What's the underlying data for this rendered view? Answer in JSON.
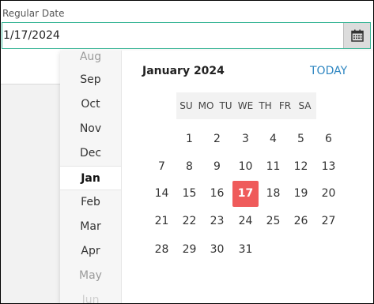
{
  "field": {
    "label": "Regular Date",
    "value": "1/17/2024",
    "button_icon": "calendar-icon"
  },
  "picker": {
    "title": "January 2024",
    "today_label": "TODAY",
    "months": [
      "Aug",
      "Sep",
      "Oct",
      "Nov",
      "Dec",
      "Jan",
      "Feb",
      "Mar",
      "Apr",
      "May",
      "Jun"
    ],
    "selected_month": "Jan",
    "weekdays": [
      "SU",
      "MO",
      "TU",
      "WE",
      "TH",
      "FR",
      "SA"
    ],
    "weeks": [
      [
        "",
        "",
        "1",
        "2",
        "3",
        "4",
        "5",
        "6"
      ],
      [
        "7",
        "8",
        "9",
        "10",
        "11",
        "12",
        "13"
      ],
      [
        "14",
        "15",
        "16",
        "17",
        "18",
        "19",
        "20"
      ],
      [
        "21",
        "22",
        "23",
        "24",
        "25",
        "26",
        "27"
      ],
      [
        "28",
        "29",
        "30",
        "31"
      ]
    ],
    "selected_day": "17",
    "accent_color": "#ef5b5b",
    "link_color": "#2e86c1",
    "focus_color": "#3fb89a"
  }
}
